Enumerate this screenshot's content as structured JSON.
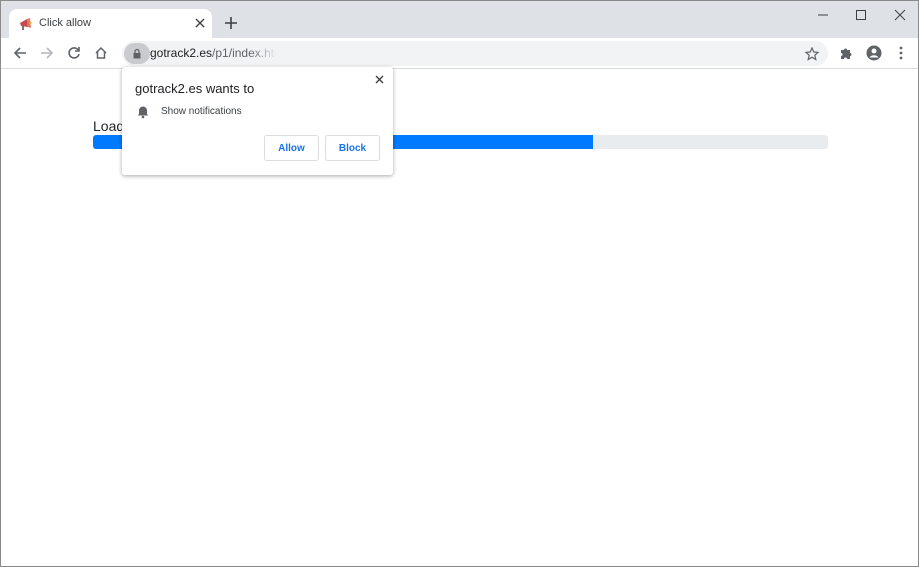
{
  "tab": {
    "title": "Click allow",
    "favicon": "megaphone-icon"
  },
  "address_bar": {
    "host": "gotrack2.es",
    "path": "/p1/index.htm"
  },
  "page": {
    "loading_label": "Loading",
    "progress_fraction": 0.68
  },
  "permission_prompt": {
    "title": "gotrack2.es wants to",
    "permission": "Show notifications",
    "allow_label": "Allow",
    "block_label": "Block"
  },
  "colors": {
    "tabstrip": "#dee1e6",
    "progress_fill": "#007bff",
    "progress_track": "#e9ecef",
    "button_text": "#1a73e8"
  }
}
